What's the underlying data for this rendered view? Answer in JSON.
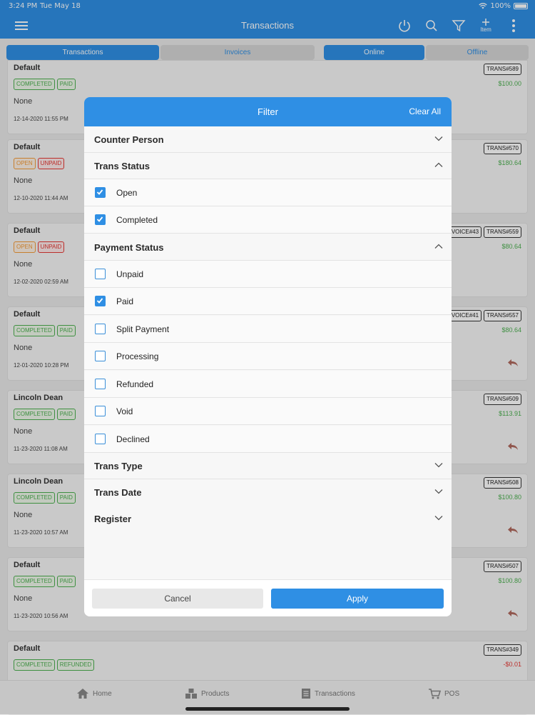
{
  "status": {
    "time": "3:24 PM",
    "date": "Tue May 18",
    "battery": "100%"
  },
  "nav": {
    "title": "Transactions",
    "add_label": "Item"
  },
  "segments": {
    "transactions": "Transactions",
    "invoices": "Invoices",
    "online": "Online",
    "offline": "Offline"
  },
  "cards": [
    {
      "name": "Default",
      "badges": [
        "COMPLETED",
        "PAID"
      ],
      "note": "None",
      "date": "12-14-2020 11:55 PM",
      "tags": [
        "TRANS#589"
      ],
      "amount": "$100.00"
    },
    {
      "name": "Default",
      "badges": [
        "OPEN",
        "UNPAID"
      ],
      "note": "None",
      "date": "12-10-2020 11:44 AM",
      "tags": [
        "TRANS#570"
      ],
      "amount": "$180.64"
    },
    {
      "name": "Default",
      "badges": [
        "OPEN",
        "UNPAID"
      ],
      "note": "None",
      "date": "12-02-2020 02:59 AM",
      "tags": [
        "INVOICE#43",
        "TRANS#559"
      ],
      "amount": "$80.64"
    },
    {
      "name": "Default",
      "badges": [
        "COMPLETED",
        "PAID"
      ],
      "note": "None",
      "date": "12-01-2020 10:28 PM",
      "tags": [
        "INVOICE#41",
        "TRANS#557"
      ],
      "amount": "$80.64"
    },
    {
      "name": "Lincoln Dean",
      "badges": [
        "COMPLETED",
        "PAID"
      ],
      "note": "None",
      "date": "11-23-2020 11:08 AM",
      "tags": [
        "TRANS#509"
      ],
      "amount": "$113.91"
    },
    {
      "name": "Lincoln Dean",
      "badges": [
        "COMPLETED",
        "PAID"
      ],
      "note": "None",
      "date": "11-23-2020 10:57 AM",
      "tags": [
        "TRANS#508"
      ],
      "amount": "$100.80"
    },
    {
      "name": "Default",
      "badges": [
        "COMPLETED",
        "PAID"
      ],
      "note": "None",
      "date": "11-23-2020 10:56 AM",
      "tags": [
        "TRANS#507"
      ],
      "amount": "$100.80"
    },
    {
      "name": "Default",
      "badges": [
        "COMPLETED",
        "REFUNDED"
      ],
      "note": "",
      "date": "",
      "tags": [
        "TRANS#349"
      ],
      "amount": "-$0.01"
    }
  ],
  "tabs": {
    "home": "Home",
    "products": "Products",
    "transactions": "Transactions",
    "pos": "POS"
  },
  "filter": {
    "title": "Filter",
    "clear_all": "Clear All",
    "counter_person": "Counter Person",
    "trans_status": "Trans Status",
    "trans_status_options": [
      {
        "label": "Open",
        "checked": true
      },
      {
        "label": "Completed",
        "checked": true
      }
    ],
    "payment_status": "Payment Status",
    "payment_status_options": [
      {
        "label": "Unpaid",
        "checked": false
      },
      {
        "label": "Paid",
        "checked": true
      },
      {
        "label": "Split Payment",
        "checked": false
      },
      {
        "label": "Processing",
        "checked": false
      },
      {
        "label": "Refunded",
        "checked": false
      },
      {
        "label": "Void",
        "checked": false
      },
      {
        "label": "Declined",
        "checked": false
      }
    ],
    "trans_type": "Trans Type",
    "trans_date": "Trans Date",
    "register": "Register",
    "cancel": "Cancel",
    "apply": "Apply"
  },
  "colors": {
    "accent": "#2f8fe4",
    "green": "#4caf50",
    "orange": "#f39b3a",
    "red": "#e53935"
  },
  "icons": [
    "menu-icon",
    "power-icon",
    "search-icon",
    "filter-icon",
    "plus-icon",
    "more-vertical-icon",
    "reply-icon",
    "home-icon",
    "products-icon",
    "transactions-icon",
    "cart-icon",
    "chevron-down-icon",
    "chevron-up-icon",
    "wifi-icon",
    "battery-icon"
  ]
}
